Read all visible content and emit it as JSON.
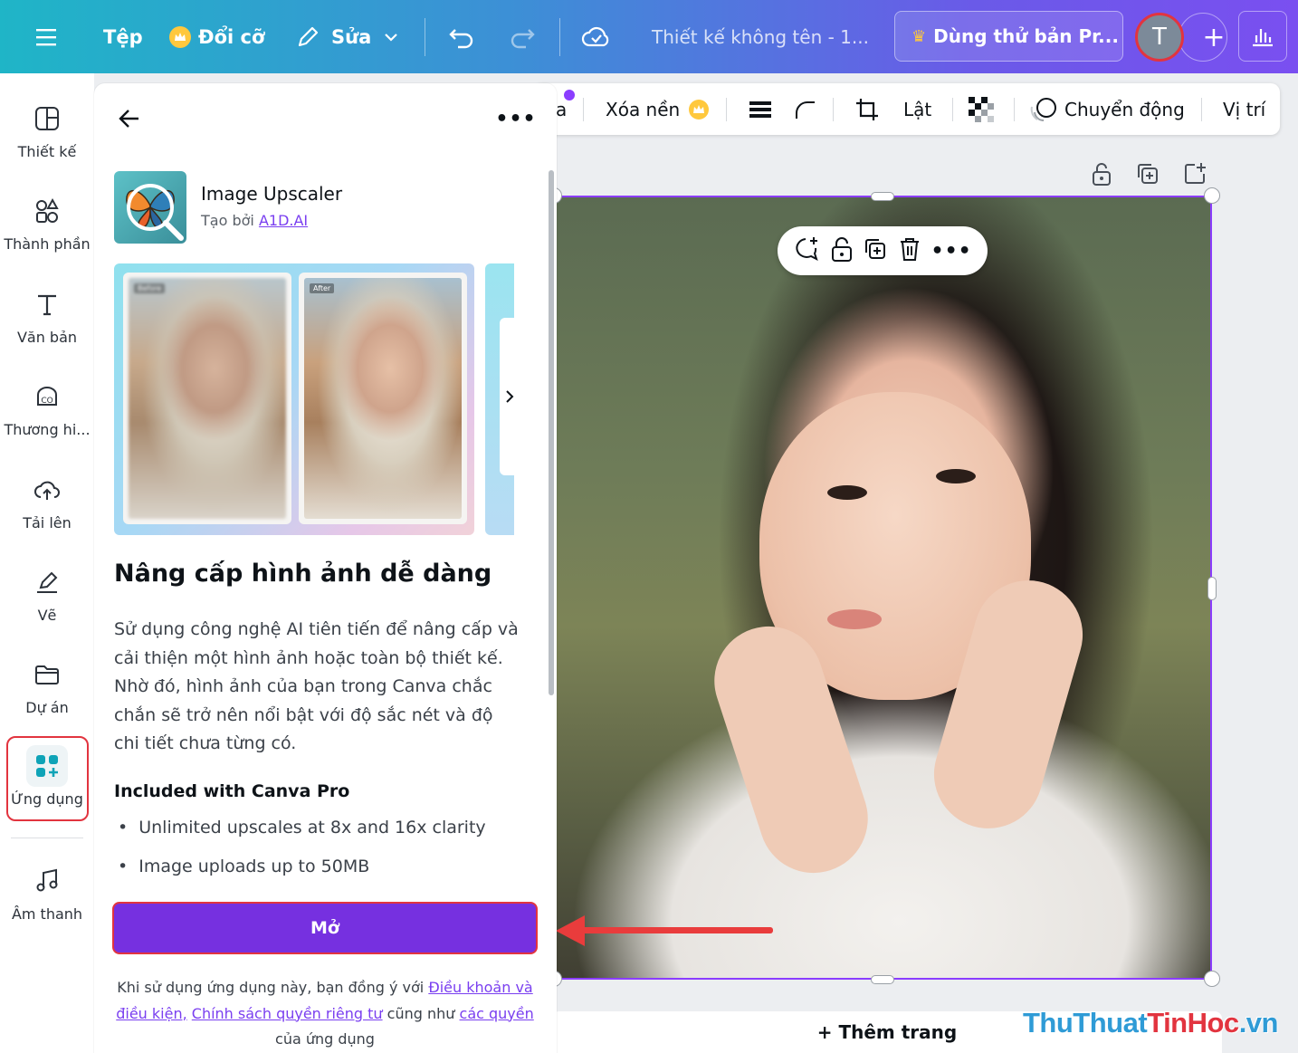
{
  "topbar": {
    "file_label": "Tệp",
    "resize_label": "Đổi cỡ",
    "edit_label": "Sửa",
    "doc_title": "Thiết kế không tên - 1...",
    "try_pro_label": "Dùng thử bản Pr...",
    "avatar_initial": "T",
    "plus_label": "+"
  },
  "rail": {
    "items": [
      {
        "label": "Thiết kế",
        "icon": "layout-icon"
      },
      {
        "label": "Thành phần",
        "icon": "elements-icon"
      },
      {
        "label": "Văn bản",
        "icon": "text-icon"
      },
      {
        "label": "Thương hi...",
        "icon": "brand-icon"
      },
      {
        "label": "Tải lên",
        "icon": "cloud-upload-icon"
      },
      {
        "label": "Vẽ",
        "icon": "draw-icon"
      },
      {
        "label": "Dự án",
        "icon": "folder-icon"
      },
      {
        "label": "Ứng dụng",
        "icon": "apps-icon"
      },
      {
        "label": "Âm thanh",
        "icon": "music-icon"
      }
    ]
  },
  "context_toolbar": {
    "partial_label": "a",
    "remove_bg": "Xóa nền",
    "flip": "Lật",
    "animate": "Chuyển động",
    "position": "Vị trí"
  },
  "panel": {
    "app_name": "Image Upscaler",
    "created_by_prefix": "Tạo bởi",
    "created_by_link": "A1D.AI",
    "before_label": "Before",
    "after_label": "After",
    "title": "Nâng cấp hình ảnh dễ dàng",
    "description": "Sử dụng công nghệ AI tiên tiến để nâng cấp và cải thiện một hình ảnh hoặc toàn bộ thiết kế. Nhờ đó, hình ảnh của bạn trong Canva chắc chắn sẽ trở nên nổi bật với độ sắc nét và độ chi tiết chưa từng có.",
    "included_heading": "Included with Canva Pro",
    "bullets": [
      "Unlimited upscales at 8x and 16x clarity",
      "Image uploads up to 50MB"
    ],
    "open_button": "Mở",
    "terms": {
      "part1": "Khi sử dụng ứng dụng này, bạn đồng ý với",
      "link1": "Điều khoản và điều kiện,",
      "link2": "Chính sách quyền riêng tư",
      "part2": "cũng như",
      "link3": "các quyền",
      "part3": "của ứng dụng"
    }
  },
  "canvas": {
    "add_page": "+ Thêm trang"
  },
  "watermark": {
    "part_blue_1": "ThuThuat",
    "part_red": "TinHoc",
    "part_blue_2": ".vn"
  },
  "colors": {
    "accent_purple": "#7630e0",
    "selection_purple": "#8b3dff",
    "highlight_red": "#e2343f",
    "crown_gold": "#ffc83d"
  }
}
